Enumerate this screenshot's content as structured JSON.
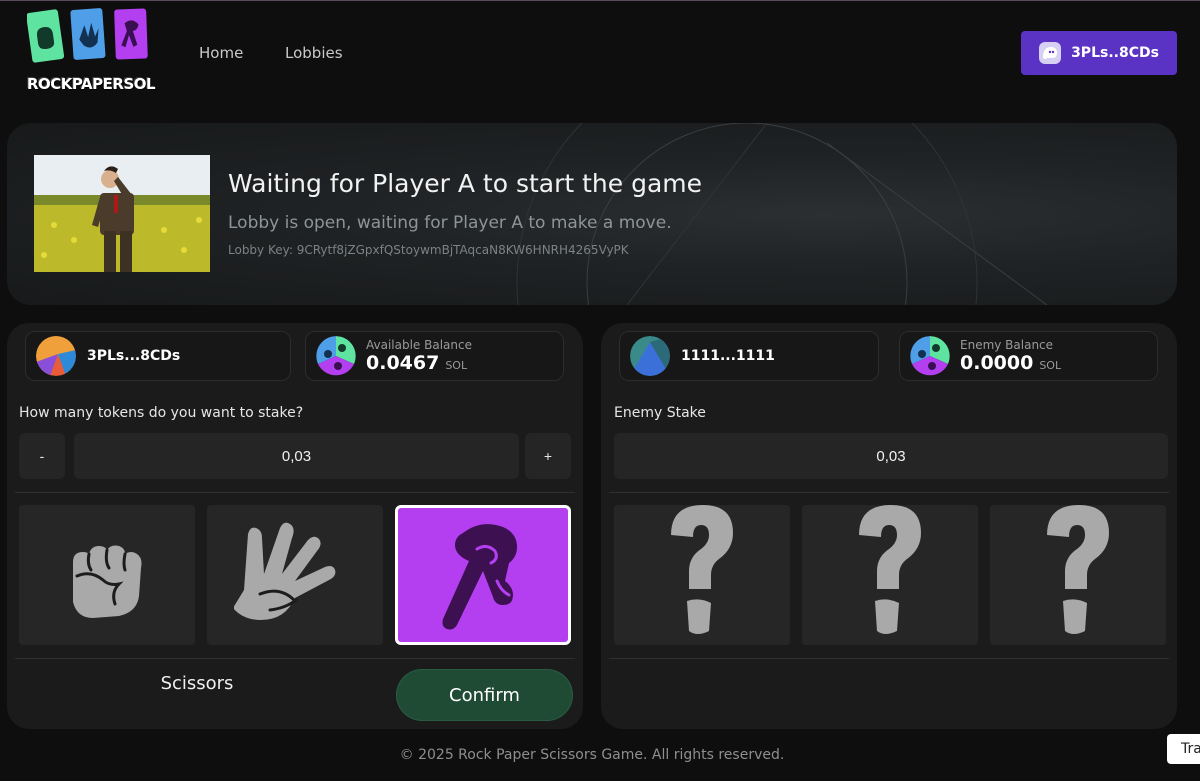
{
  "header": {
    "logo_text": "ROCKPAPERSOL",
    "nav": [
      {
        "label": "Home"
      },
      {
        "label": "Lobbies"
      }
    ],
    "wallet_label": "3PLs..8CDs"
  },
  "banner": {
    "title": "Waiting for Player A to start the game",
    "subtitle": "Lobby is open, waiting for Player A to make a move.",
    "lobby_key": "Lobby Key: 9CRytf8jZGpxfQStoywmBjTAqcaN8KW6HNRH4265VyPK"
  },
  "player": {
    "address": "3PLs...8CDs",
    "balance_label": "Available Balance",
    "balance_value": "0.0467",
    "balance_unit": "SOL",
    "stake_question": "How many tokens do you want to stake?",
    "decrement_label": "-",
    "stake_value": "0,03",
    "increment_label": "+",
    "choices": [
      {
        "icon": "rock-fist-icon",
        "selected": false
      },
      {
        "icon": "paper-hand-icon",
        "selected": false
      },
      {
        "icon": "scissors-hand-icon",
        "selected": true
      }
    ],
    "selected_choice": "Scissors",
    "confirm_label": "Confirm"
  },
  "enemy": {
    "address": "1111...1111",
    "balance_label": "Enemy Balance",
    "balance_value": "0.0000",
    "balance_unit": "SOL",
    "stake_label": "Enemy Stake",
    "stake_value": "0,03",
    "choices": [
      {
        "icon": "question-mark-icon"
      },
      {
        "icon": "question-mark-icon"
      },
      {
        "icon": "question-mark-icon"
      }
    ]
  },
  "footer": {
    "text": "© 2025 Rock Paper Scissors Game. All rights reserved."
  },
  "translate_label": "Tra",
  "colors": {
    "wallet_button": "#5b33c4",
    "selected_choice": "#b43ff0",
    "confirm_button": "#1f4b35",
    "logo_green": "#5fe3a1",
    "logo_blue": "#4f9ee8",
    "logo_purple": "#b43ff0"
  }
}
